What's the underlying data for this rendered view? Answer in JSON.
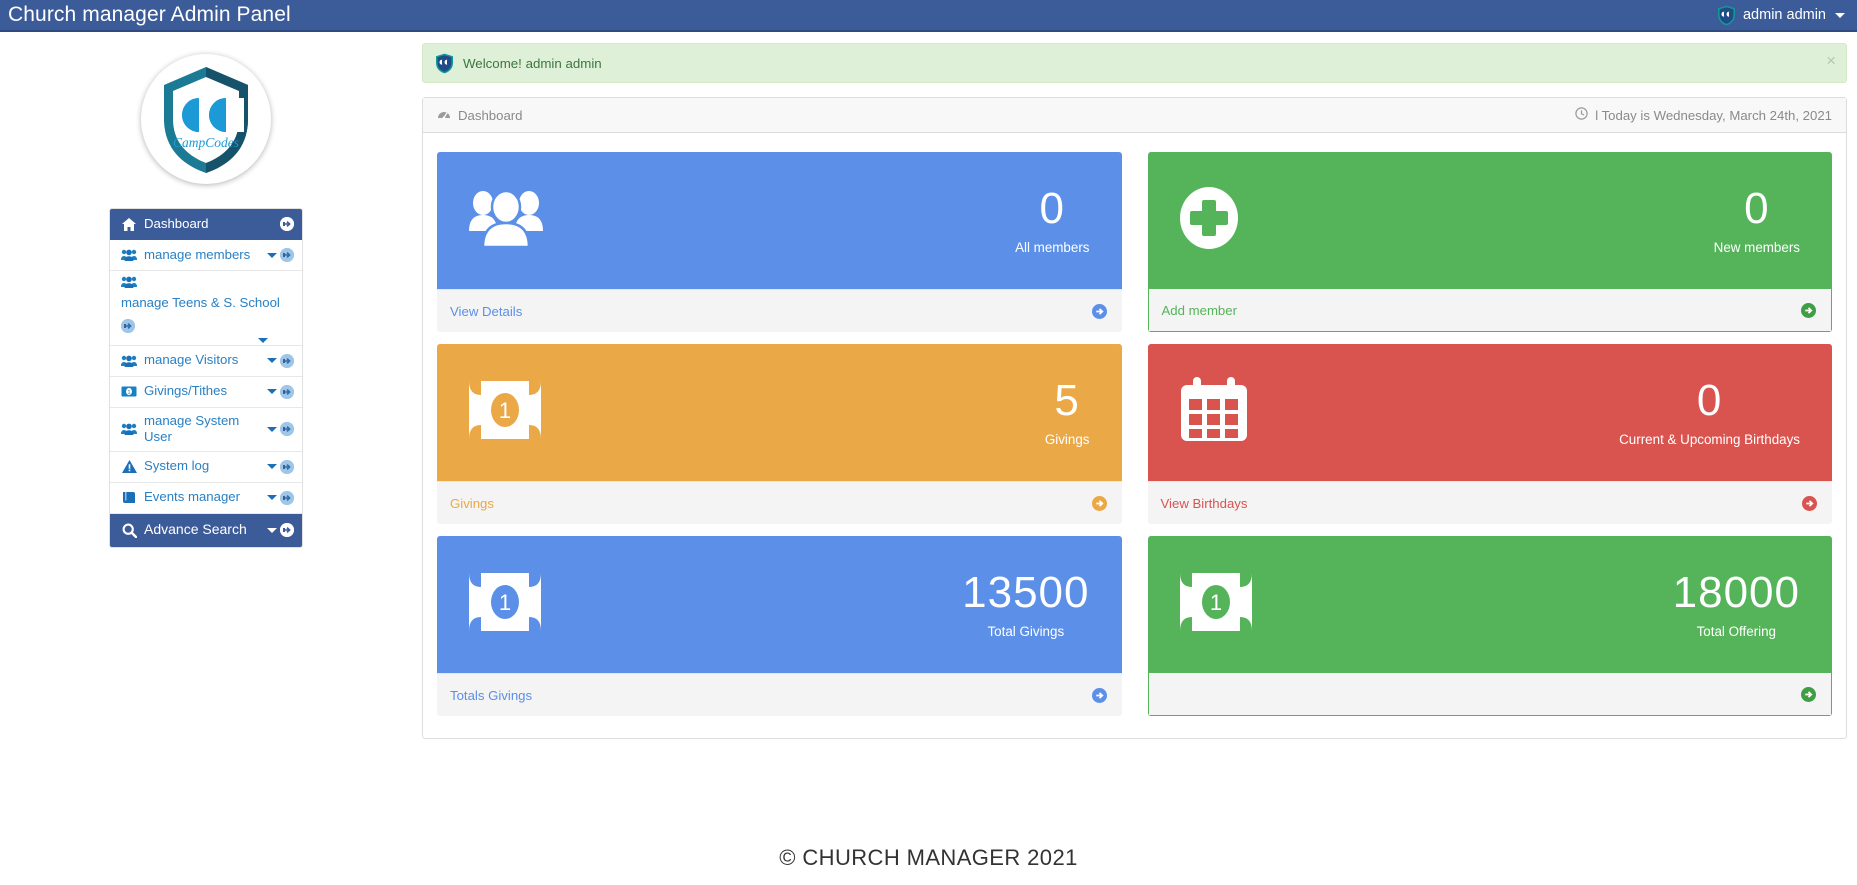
{
  "navbar": {
    "brand": "Church manager Admin Panel",
    "user": "admin admin"
  },
  "sidebar": {
    "logo_text": "CampCodes",
    "items": [
      {
        "label": "Dashboard",
        "icon": "home-icon",
        "active": true,
        "caret": false,
        "arrow": true
      },
      {
        "label": "manage members",
        "icon": "users-icon",
        "active": false,
        "caret": true,
        "arrow": true
      },
      {
        "label": "manage Teens & S. School",
        "icon": "users-icon",
        "active": false,
        "caret": true,
        "arrow": true
      },
      {
        "label": "manage Visitors",
        "icon": "users-icon",
        "active": false,
        "caret": true,
        "arrow": true
      },
      {
        "label": "Givings/Tithes",
        "icon": "money-icon",
        "active": false,
        "caret": true,
        "arrow": true
      },
      {
        "label": "manage System User",
        "icon": "users-icon",
        "active": false,
        "caret": true,
        "arrow": true
      },
      {
        "label": "System log",
        "icon": "warning-icon",
        "active": false,
        "caret": true,
        "arrow": true
      },
      {
        "label": "Events manager",
        "icon": "book-icon",
        "active": false,
        "caret": true,
        "arrow": true
      },
      {
        "label": "Advance Search",
        "icon": "search-icon",
        "active": true,
        "caret": true,
        "arrow": true
      }
    ]
  },
  "alert": {
    "icon": "shield-logo-icon",
    "message": "Welcome! admin admin",
    "close_label": "×"
  },
  "panel": {
    "title": "Dashboard",
    "title_icon": "dashboard-icon",
    "date_icon": "clock-icon",
    "date_text": "l Today is Wednesday, March 24th, 2021"
  },
  "cards": [
    {
      "value": "0",
      "label": "All members",
      "footer_label": "View Details",
      "icon": "group-users-icon",
      "color": "#5b8fe8",
      "top_class": "c-blue",
      "foot_text_class": "f-blue",
      "foot_arrow_class": "b-blue"
    },
    {
      "value": "0",
      "label": "New members",
      "footer_label": "Add member",
      "icon": "plus-circle-icon",
      "color": "#55b45a",
      "top_class": "c-green",
      "foot_text_class": "f-green",
      "foot_arrow_class": "b-green"
    },
    {
      "value": "5",
      "label": "Givings",
      "footer_label": "Givings",
      "icon": "money-bill-icon",
      "color": "#eaa847",
      "top_class": "c-orange",
      "foot_text_class": "f-orange",
      "foot_arrow_class": "b-orange"
    },
    {
      "value": "0",
      "label": "Current & Upcoming Birthdays",
      "footer_label": "View Birthdays",
      "icon": "calendar-icon",
      "color": "#d9534f",
      "top_class": "c-red",
      "foot_text_class": "f-red",
      "foot_arrow_class": "b-red"
    },
    {
      "value": "13500",
      "label": "Total Givings",
      "footer_label": "Totals Givings",
      "icon": "money-bill-icon",
      "color": "#5b8fe8",
      "top_class": "c-blue",
      "foot_text_class": "f-blue",
      "foot_arrow_class": "b-blue"
    },
    {
      "value": "18000",
      "label": "Total Offering",
      "footer_label": "",
      "icon": "money-bill-icon",
      "color": "#55b45a",
      "top_class": "c-green",
      "foot_text_class": "f-green",
      "foot_arrow_class": "b-green"
    }
  ],
  "footer": {
    "copyright": "© CHURCH MANAGER 2021"
  }
}
